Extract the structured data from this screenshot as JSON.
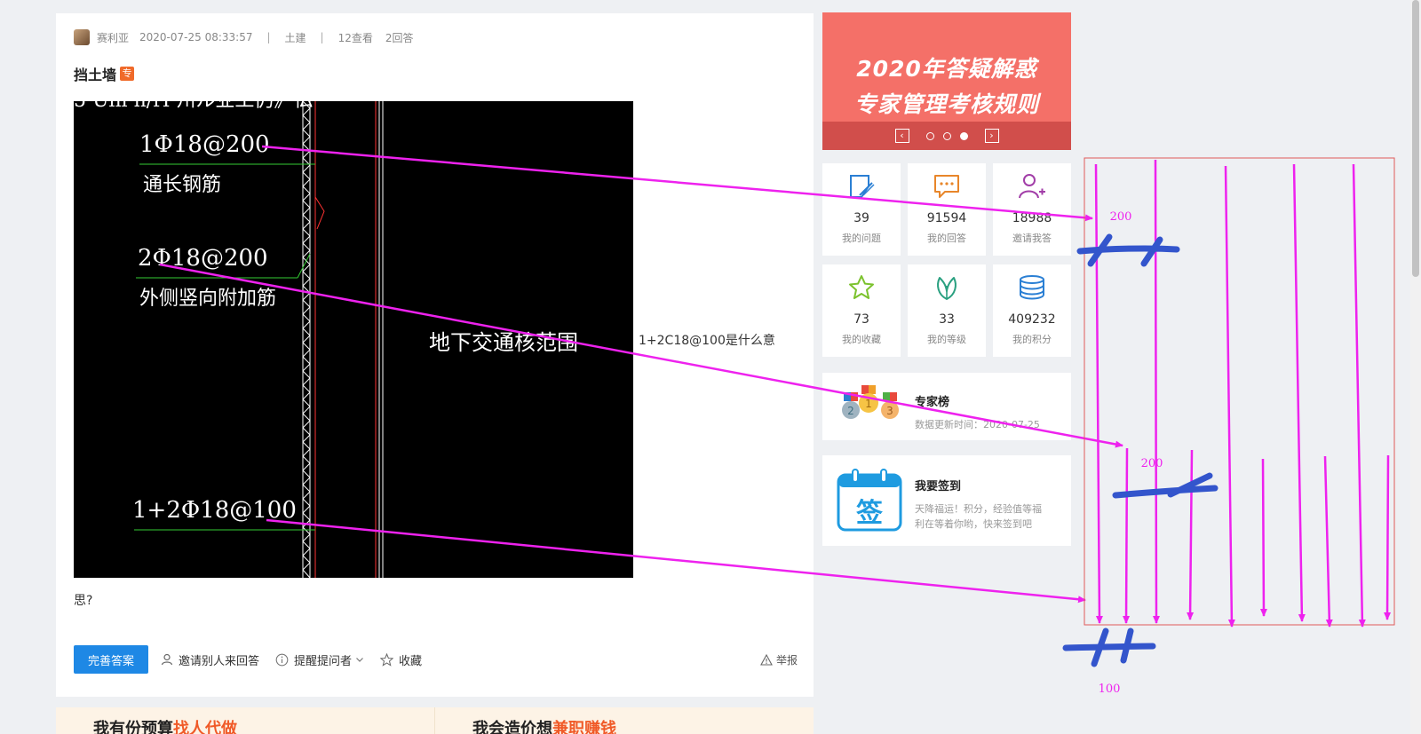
{
  "question": {
    "author": "赛利亚",
    "date": "2020-07-25 08:33:57",
    "category": "土建",
    "views": "12查看",
    "answers": "2回答",
    "title": "挡土墙",
    "title_badge": "专",
    "text_part1": "1+2C18@100是什么意",
    "text_part2": "思?"
  },
  "cad": {
    "label1": "1Φ18@200",
    "label1_desc": "通长钢筋",
    "label2": "2Φ18@200",
    "label2_desc": "外侧竖向附加筋",
    "label3": "1+2Φ18@100",
    "zone_label": "地下交通核范围"
  },
  "actions": {
    "complete_answer": "完善答案",
    "invite": "邀请别人来回答",
    "remind": "提醒提问者",
    "favorite": "收藏",
    "report": "举报"
  },
  "bottom_banners": [
    {
      "prefix": "我有份预算",
      "highlight": "找人代做"
    },
    {
      "prefix": "我会造价想",
      "highlight": "兼职赚钱"
    }
  ],
  "sidebar": {
    "banner_line1": "2020年答疑解惑",
    "banner_line2": "专家管理考核规则",
    "stats": [
      {
        "num": "39",
        "label": "我的问题",
        "icon": "edit-note-icon"
      },
      {
        "num": "91594",
        "label": "我的回答",
        "icon": "chat-bubble-icon"
      },
      {
        "num": "18988",
        "label": "邀请我答",
        "icon": "add-user-icon"
      },
      {
        "num": "73",
        "label": "我的收藏",
        "icon": "star-icon"
      },
      {
        "num": "33",
        "label": "我的等级",
        "icon": "leaf-icon"
      },
      {
        "num": "409232",
        "label": "我的积分",
        "icon": "coin-stack-icon"
      }
    ],
    "experts": {
      "title": "专家榜",
      "updated": "数据更新时间：2020-07-25"
    },
    "signin": {
      "title": "我要签到",
      "desc_line1": "天降福运！积分，经验值等福",
      "desc_line2": "利在等着你哟，快来签到吧",
      "icon_text": "签"
    }
  },
  "annotation": {
    "top_dim": "200",
    "mid_dim": "200",
    "bottom_dim": "100"
  },
  "colors": {
    "primary": "#1e88e5",
    "annotation": "#ee22ee",
    "annotation_blue": "#3355cc",
    "banner": "#f47068"
  }
}
